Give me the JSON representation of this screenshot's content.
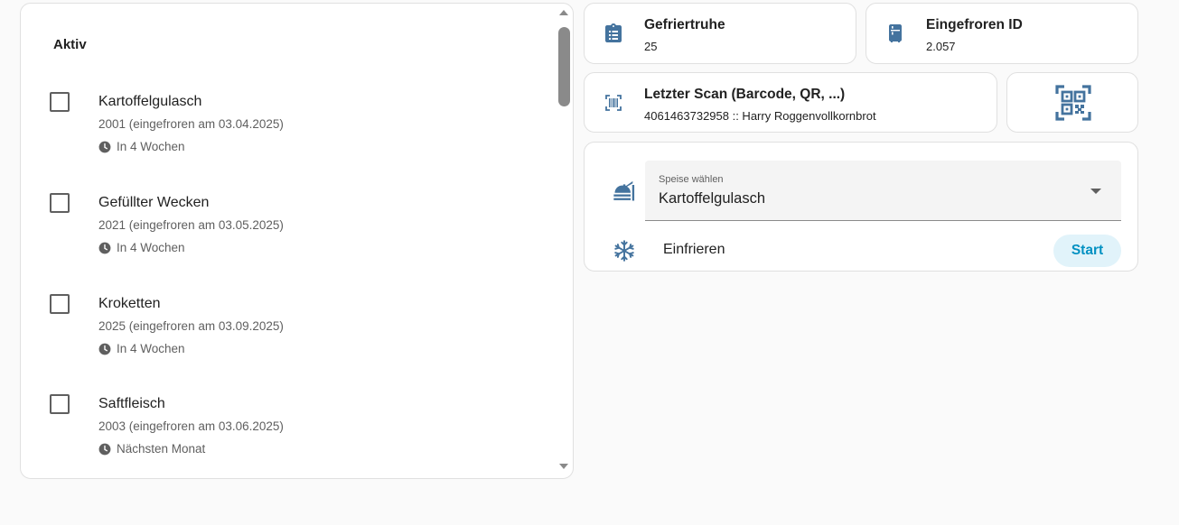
{
  "todo": {
    "title": "Aktiv",
    "items": [
      {
        "name": "Kartoffelgulasch",
        "detail": "2001 (eingefroren am 03.04.2025)",
        "due": "In 4 Wochen",
        "checked": false
      },
      {
        "name": "Gefüllter Wecken",
        "detail": "2021 (eingefroren am 03.05.2025)",
        "due": "In 4 Wochen",
        "checked": false
      },
      {
        "name": "Kroketten",
        "detail": "2025 (eingefroren am 03.09.2025)",
        "due": "In 4 Wochen",
        "checked": false
      },
      {
        "name": "Saftfleisch",
        "detail": "2003 (eingefroren am 03.06.2025)",
        "due": "Nächsten Monat",
        "checked": false
      }
    ]
  },
  "tiles": {
    "freezer": {
      "name": "Gefriertruhe",
      "state": "25",
      "icon": "clipboard-list-icon"
    },
    "frozen_id": {
      "name": "Eingefroren ID",
      "state": "2.057",
      "icon": "freezer-icon"
    },
    "last_scan": {
      "name": "Letzter Scan (Barcode, QR, ...)",
      "state": "4061463732958 :: Harry Roggenvollkornbrot",
      "icon": "barcode-scan-icon"
    },
    "qr": {
      "icon": "qrcode-scan-icon"
    }
  },
  "entities": {
    "select": {
      "label": "Speise wählen",
      "value": "Kartoffelgulasch",
      "icon": "food-serving-icon"
    },
    "freeze": {
      "label": "Einfrieren",
      "button": "Start",
      "icon": "snowflake-icon"
    }
  },
  "colors": {
    "icon": "#44739e",
    "button_bg": "#e1f3fa",
    "button_text": "#0391c2"
  }
}
